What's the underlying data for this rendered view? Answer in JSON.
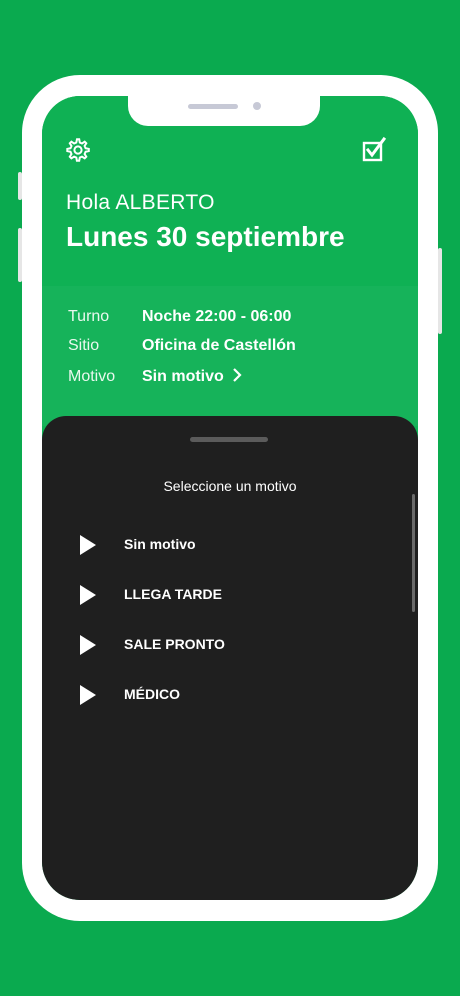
{
  "header": {
    "settings_icon": "gear-icon",
    "edit_icon": "checkbox-edit-icon",
    "greeting": "Hola ALBERTO",
    "date": "Lunes 30 septiembre"
  },
  "info": {
    "turno_label": "Turno",
    "turno_value": "Noche 22:00 - 06:00",
    "sitio_label": "Sitio",
    "sitio_value": "Oficina de Castellón",
    "motivo_label": "Motivo",
    "motivo_value": "Sin motivo"
  },
  "sheet": {
    "title": "Seleccione un motivo",
    "options": [
      {
        "label": "Sin motivo"
      },
      {
        "label": "LLEGA TARDE"
      },
      {
        "label": "SALE PRONTO"
      },
      {
        "label": "MÉDICO"
      }
    ]
  },
  "colors": {
    "background": "#0aaa4f",
    "header": "#0fb154",
    "sheet": "#1f1f1f"
  }
}
